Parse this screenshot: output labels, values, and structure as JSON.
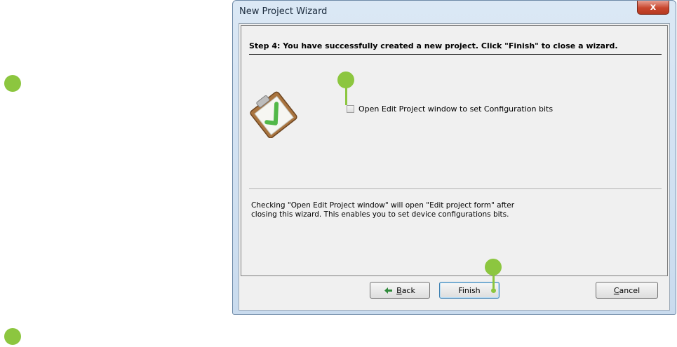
{
  "window": {
    "title": "New Project Wizard",
    "close_symbol": "x"
  },
  "wizard": {
    "step_text": "Step 4: You have successfully created a new project.  Click \"Finish\" to close a wizard.",
    "checkbox_label": "Open Edit Project window to set Configuration bits",
    "checkbox_checked": false,
    "info_line1": "Checking \"Open Edit Project window\" will open \"Edit project form\" after",
    "info_line2": "closing this wizard. This enables you to set device configurations bits."
  },
  "buttons": {
    "back_mnemonic": "B",
    "back_rest": "ack",
    "finish": "Finish",
    "cancel_mnemonic": "C",
    "cancel_rest": "ancel"
  },
  "icons": [
    "clipboard-check-icon",
    "back-arrow-icon",
    "close-icon"
  ],
  "colors": {
    "callout": "#8cc63f",
    "close_button": "#c8462d",
    "check": "#52b848"
  }
}
